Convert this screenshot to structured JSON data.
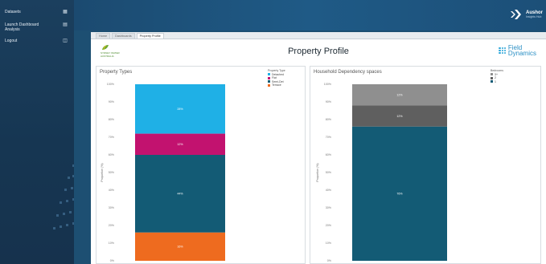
{
  "sidebar": {
    "items": [
      {
        "label": "Datasets",
        "icon": "grid-icon"
      },
      {
        "label": "Launch Dashboard Analysis",
        "icon": "document-icon"
      },
      {
        "label": "Logout",
        "icon": "logout-icon"
      }
    ]
  },
  "brand": {
    "name": "Aushor",
    "tagline": "Insights Hub"
  },
  "tabs": [
    {
      "label": "Home",
      "active": false
    },
    {
      "label": "Dashboards",
      "active": false
    },
    {
      "label": "Property Profile",
      "active": true
    }
  ],
  "header": {
    "title": "Property Profile",
    "left_logo": {
      "line1": "SYDNEY WATER",
      "line2": "AUSTRALIA"
    },
    "right_logo": {
      "line1": "Field",
      "line2": "Dynamics"
    }
  },
  "colors": {
    "house": "#1fb0e6",
    "flat": "#c2126f",
    "semi_det": "#135b75",
    "terrace": "#ee6b1f",
    "bed_3plus": "#8f8f8f",
    "bed_2": "#5f5f5f",
    "bed_1": "#135b75"
  },
  "chart_data": [
    {
      "type": "bar",
      "title": "Property Types",
      "legend_title": "Property Type",
      "legend_position": "top-right",
      "series": [
        {
          "name": "Detached",
          "value": 28,
          "color_key": "house"
        },
        {
          "name": "Flat",
          "value": 12,
          "color_key": "flat"
        },
        {
          "name": "Semi-Det",
          "value": 44,
          "color_key": "semi_det"
        },
        {
          "name": "Terrace",
          "value": 16,
          "color_key": "terrace"
        }
      ],
      "ylabel": "Proportion (%)",
      "ylim": [
        0,
        100
      ],
      "yticks": [
        "0%",
        "10%",
        "20%",
        "30%",
        "40%",
        "50%",
        "60%",
        "70%",
        "80%",
        "90%",
        "100%"
      ]
    },
    {
      "type": "bar",
      "title": "Household Dependency spaces",
      "legend_title": "Bedrooms",
      "legend_position": "top-right",
      "series": [
        {
          "name": "3+",
          "value": 12,
          "color_key": "bed_3plus"
        },
        {
          "name": "2",
          "value": 12,
          "color_key": "bed_2"
        },
        {
          "name": "1",
          "value": 76,
          "color_key": "bed_1"
        }
      ],
      "ylabel": "Proportion (%)",
      "ylim": [
        0,
        100
      ],
      "yticks": [
        "0%",
        "10%",
        "20%",
        "30%",
        "40%",
        "50%",
        "60%",
        "70%",
        "80%",
        "90%",
        "100%"
      ]
    }
  ]
}
